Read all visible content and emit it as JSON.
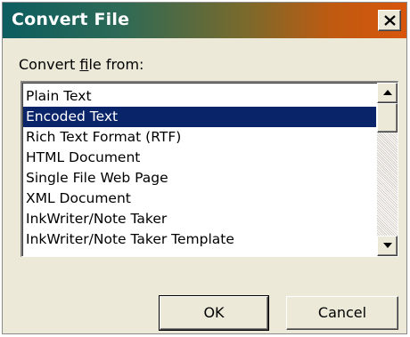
{
  "window": {
    "title": "Convert File",
    "close_icon": "close-icon"
  },
  "field": {
    "label_before": "Convert ",
    "label_access_key": "f",
    "label_after": "ile from:"
  },
  "list": {
    "selected_index": 1,
    "items": [
      "Plain Text",
      "Encoded Text",
      "Rich Text Format (RTF)",
      "HTML Document",
      "Single File Web Page",
      "XML Document",
      "InkWriter/Note Taker",
      "InkWriter/Note Taker Template"
    ]
  },
  "buttons": {
    "ok_label": "OK",
    "cancel_label": "Cancel"
  },
  "colors": {
    "selection_background": "#0a246a",
    "selection_text": "#ffffff",
    "dialog_face": "#ece9d8"
  }
}
